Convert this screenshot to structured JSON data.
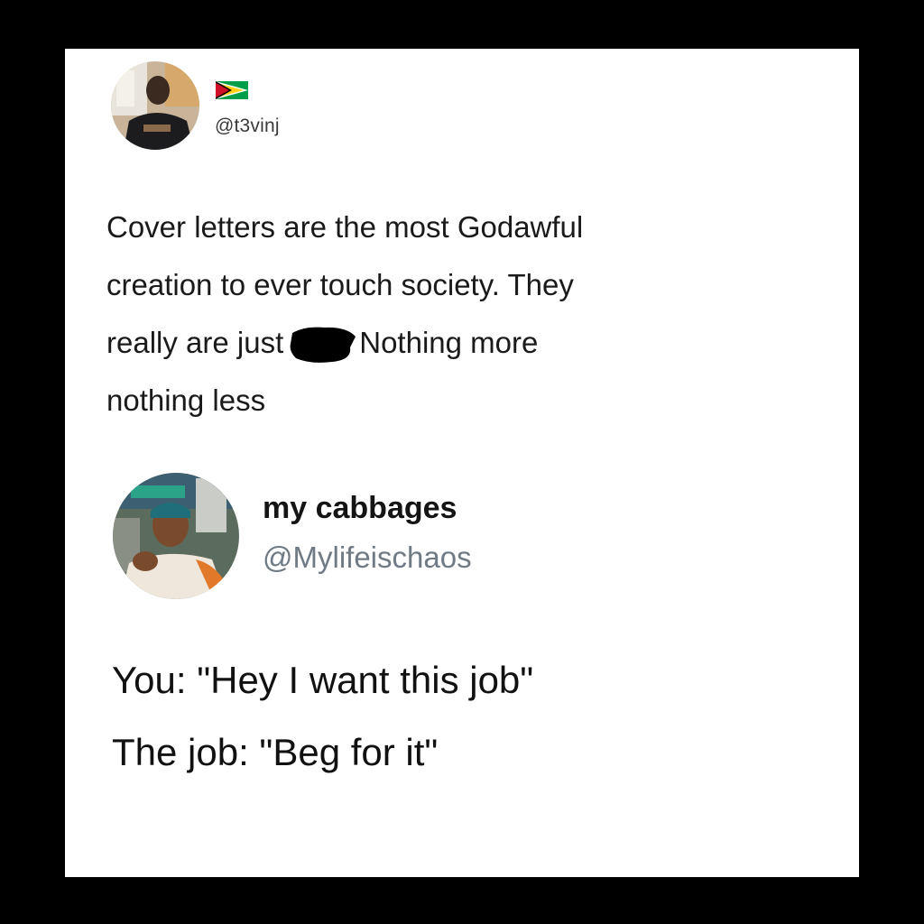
{
  "tweet": {
    "handle": "@t3vinj",
    "lines": [
      "Cover letters are the most Godawful",
      "creation to ever touch society. They",
      "really are just",
      "Nothing more",
      "nothing less"
    ]
  },
  "reply": {
    "display_name": "my cabbages",
    "handle": "@Mylifeischaos",
    "lines": [
      "You: \"Hey I want this job\"",
      "The job: \"Beg for it\""
    ]
  },
  "icons": {
    "flag": "guyana-flag-icon",
    "redaction": "redacted-emoji"
  },
  "colors": {
    "background": "#000000",
    "card": "#ffffff",
    "text": "#1a1a1a",
    "handle_secondary": "#6f7a84"
  }
}
